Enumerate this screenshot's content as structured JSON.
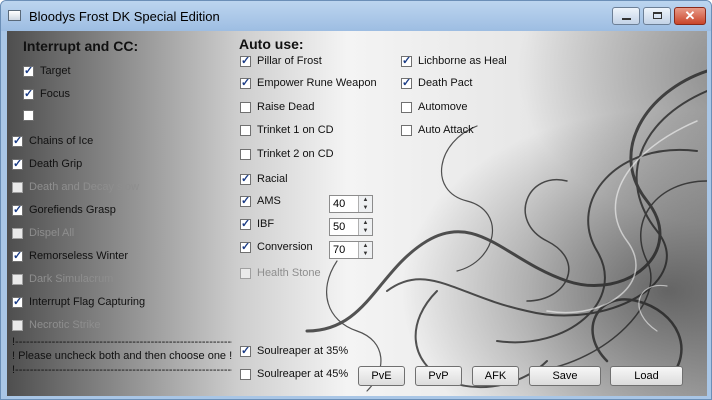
{
  "window": {
    "title": "Bloodys Frost DK Special Edition",
    "minimize_glyph": "_",
    "maximize_glyph": "□",
    "close_glyph": "✕"
  },
  "interrupt_cc": {
    "heading": "Interrupt and CC:",
    "target_option": {
      "label": "Target",
      "checked": true
    },
    "focus_option": {
      "label": "Focus",
      "checked": true
    },
    "unnamed_option": {
      "label": "",
      "checked": false
    },
    "items": [
      {
        "label": "Chains of Ice",
        "checked": true,
        "enabled": true
      },
      {
        "label": "Death Grip",
        "checked": true,
        "enabled": true
      },
      {
        "label": "Death and Decay slow",
        "checked": false,
        "enabled": false
      },
      {
        "label": "Gorefiends Grasp",
        "checked": true,
        "enabled": true
      },
      {
        "label": "Dispel All",
        "checked": false,
        "enabled": false
      },
      {
        "label": "Remorseless Winter",
        "checked": true,
        "enabled": true
      },
      {
        "label": "Dark Simulacrum",
        "checked": false,
        "enabled": false
      },
      {
        "label": "Interrupt Flag Capturing",
        "checked": true,
        "enabled": true
      },
      {
        "label": "Necrotic Strike",
        "checked": false,
        "enabled": false
      }
    ],
    "notice_rule_top": "!-------------------------------------------------------------------------",
    "notice_text": "! Please uncheck both and then choose one !",
    "notice_rule_bottom": "!-------------------------------------------------------------------------"
  },
  "auto_use": {
    "heading": "Auto use:",
    "col1": [
      {
        "label": "Pillar of Frost",
        "checked": true,
        "enabled": true
      },
      {
        "label": "Empower Rune Weapon",
        "checked": true,
        "enabled": true
      },
      {
        "label": "Raise Dead",
        "checked": false,
        "enabled": true
      },
      {
        "label": "Trinket 1 on CD",
        "checked": false,
        "enabled": true
      },
      {
        "label": "Trinket 2 on CD",
        "checked": false,
        "enabled": true
      },
      {
        "label": "Racial",
        "checked": true,
        "enabled": true
      },
      {
        "label": "AMS",
        "checked": true,
        "enabled": true,
        "value": "40"
      },
      {
        "label": "IBF",
        "checked": true,
        "enabled": true,
        "value": "50"
      },
      {
        "label": "Conversion",
        "checked": true,
        "enabled": true,
        "value": "70"
      },
      {
        "label": "Health Stone",
        "checked": false,
        "enabled": false
      }
    ],
    "col2": [
      {
        "label": "Lichborne as Heal",
        "checked": true,
        "enabled": true
      },
      {
        "label": "Death Pact",
        "checked": true,
        "enabled": true
      },
      {
        "label": "Automove",
        "checked": false,
        "enabled": true
      },
      {
        "label": "Auto Attack",
        "checked": false,
        "enabled": true
      }
    ],
    "soulreaper_35": {
      "label": "Soulreaper at 35%",
      "checked": true
    },
    "soulreaper_45": {
      "label": "Soulreaper at 45%",
      "checked": false
    }
  },
  "buttons": {
    "pve": "PvE",
    "pvp": "PvP",
    "afk": "AFK",
    "save": "Save",
    "load": "Load"
  }
}
